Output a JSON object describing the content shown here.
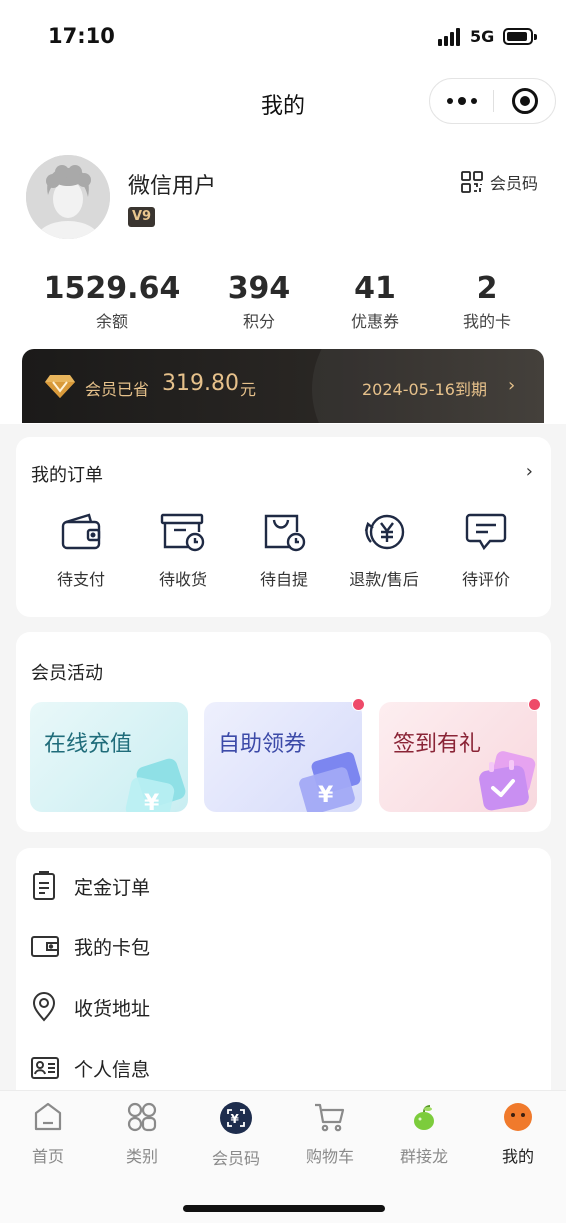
{
  "status_bar": {
    "time": "17:10",
    "network": "5G"
  },
  "nav": {
    "title": "我的"
  },
  "profile": {
    "username": "微信用户",
    "level": "V9",
    "member_code_label": "会员码"
  },
  "stats": [
    {
      "value": "1529.64",
      "label": "余额"
    },
    {
      "value": "394",
      "label": "积分"
    },
    {
      "value": "41",
      "label": "优惠券"
    },
    {
      "value": "2",
      "label": "我的卡"
    }
  ],
  "vip": {
    "saved_label": "会员已省",
    "saved_amount": "319.80",
    "saved_unit": "元",
    "expiry": "2024-05-16到期",
    "arrow": "›",
    "colors": {
      "gold": "#e6c18b",
      "dark": "#1b1a19"
    }
  },
  "orders": {
    "title": "我的订单",
    "arrow": "›",
    "items": [
      {
        "label": "待支付",
        "icon": "wallet-icon"
      },
      {
        "label": "待收货",
        "icon": "box-clock-icon"
      },
      {
        "label": "待自提",
        "icon": "bag-clock-icon"
      },
      {
        "label": "退款/售后",
        "icon": "refund-icon"
      },
      {
        "label": "待评价",
        "icon": "comment-icon"
      }
    ]
  },
  "activities": {
    "title": "会员活动",
    "items": [
      {
        "label": "在线充值",
        "color": "#1f6c7a",
        "badge": false
      },
      {
        "label": "自助领券",
        "color": "#3c4aa8",
        "badge": true
      },
      {
        "label": "签到有礼",
        "color": "#8a2436",
        "badge": true
      }
    ]
  },
  "menu": [
    {
      "label": "定金订单",
      "icon": "deposit-order-icon"
    },
    {
      "label": "我的卡包",
      "icon": "card-wallet-icon"
    },
    {
      "label": "收货地址",
      "icon": "location-pin-icon"
    },
    {
      "label": "个人信息",
      "icon": "id-card-icon"
    }
  ],
  "tabbar": {
    "items": [
      {
        "label": "首页",
        "icon": "home-icon"
      },
      {
        "label": "类别",
        "icon": "category-icon"
      },
      {
        "label": "会员码",
        "icon": "member-code-icon"
      },
      {
        "label": "购物车",
        "icon": "cart-icon"
      },
      {
        "label": "群接龙",
        "icon": "group-relay-icon"
      },
      {
        "label": "我的",
        "icon": "profile-icon"
      }
    ],
    "active_index": 5,
    "active_color": "#222222",
    "inactive_color": "#8a8a8a"
  }
}
